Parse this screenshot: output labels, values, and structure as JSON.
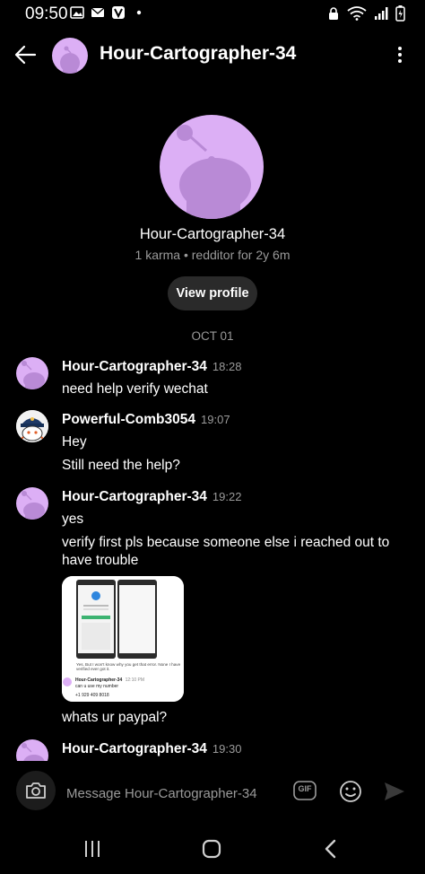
{
  "status_bar": {
    "time": "09:50"
  },
  "header": {
    "title": "Hour-Cartographer-34",
    "back_icon": "arrow-left-icon",
    "menu_icon": "kebab-icon"
  },
  "profile": {
    "name": "Hour-Cartographer-34",
    "meta": "1 karma • redditor for 2y 6m",
    "view_button": "View profile"
  },
  "date_separator": "OCT 01",
  "messages": [
    {
      "user": "Hour-Cartographer-34",
      "time": "18:28",
      "lines": [
        "need help verify wechat"
      ]
    },
    {
      "user": "Powerful-Comb3054",
      "time": "19:07",
      "lines": [
        "Hey",
        "Still need the help?"
      ]
    },
    {
      "user": "Hour-Cartographer-34",
      "time": "19:22",
      "lines": [
        "yes",
        "verify first pls because someone else i reached out to have trouble",
        "whats ur paypal?"
      ]
    },
    {
      "user": "Hour-Cartographer-34",
      "time": "19:30",
      "lines": []
    }
  ],
  "attachment": {
    "inner_text": "Yes. But I won't know why you get that error. None I have verified ever got it.",
    "inner_user": "Hour-Cartographer-34",
    "inner_time": "12:10 PM",
    "inner_msg": "can u use my number",
    "inner_phone": "+1 929 409 8018"
  },
  "composer": {
    "placeholder": "Message Hour-Cartographer-34",
    "gif_label": "GIF"
  },
  "colors": {
    "avatar_bg": "#dcaff5",
    "avatar_fg": "#b98ad6",
    "background": "#000000",
    "pill": "#2a2a2a",
    "muted": "#9a9a9a"
  }
}
